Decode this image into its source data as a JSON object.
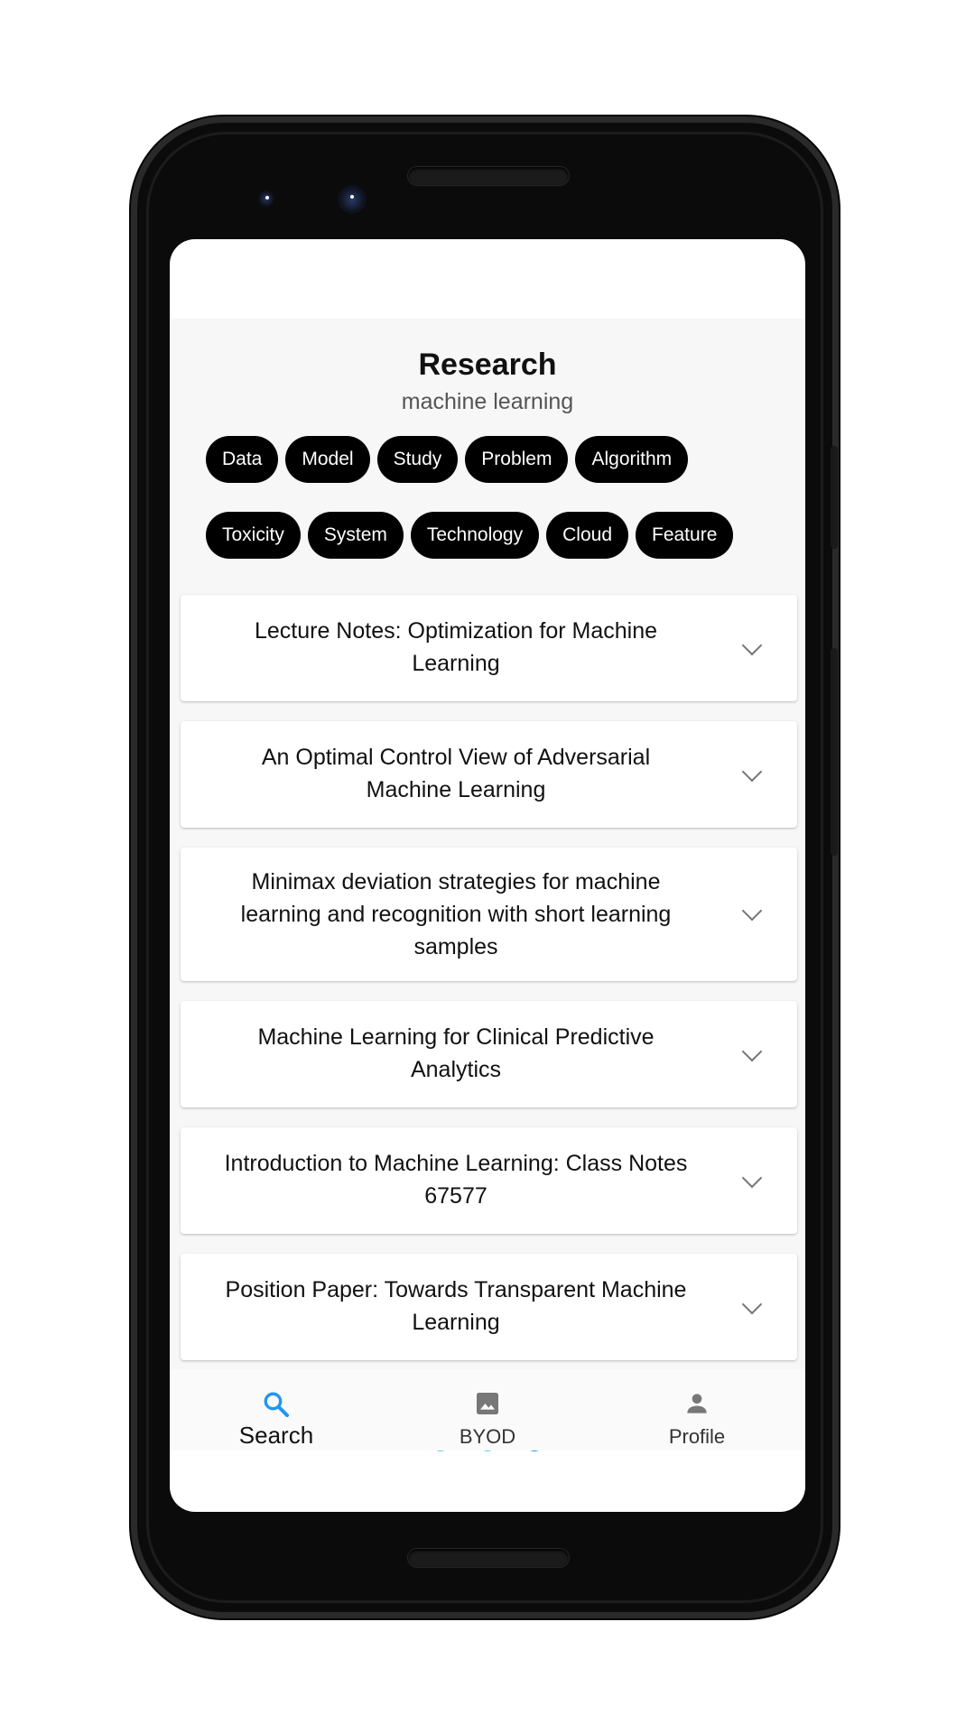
{
  "header": {
    "title": "Research",
    "query": "machine learning"
  },
  "chips": {
    "row1": [
      "Data",
      "Model",
      "Study",
      "Problem",
      "Algorithm"
    ],
    "row2": [
      "Toxicity",
      "System",
      "Technology",
      "Cloud",
      "Feature"
    ]
  },
  "results": [
    {
      "title": "Lecture Notes: Optimization for Machine Learning"
    },
    {
      "title": "An Optimal Control View of Adversarial Machine Learning"
    },
    {
      "title": "Minimax deviation strategies for machine learning and recognition with  short learning samples"
    },
    {
      "title": "Machine Learning for Clinical Predictive Analytics"
    },
    {
      "title": "Introduction to Machine Learning: Class Notes 67577"
    },
    {
      "title": "Position Paper: Towards Transparent Machine Learning"
    }
  ],
  "pager": {
    "count": 3,
    "active_index": 2,
    "active_color": "#2196f3",
    "inactive_color": "#5ac8fa"
  },
  "bottom_nav": {
    "search_label": "Search",
    "byod_label": "BYOD",
    "profile_label": "Profile",
    "active": "search",
    "active_color": "#2196f3",
    "icons": {
      "search": "search-icon",
      "byod": "image-icon",
      "profile": "person-icon"
    }
  }
}
